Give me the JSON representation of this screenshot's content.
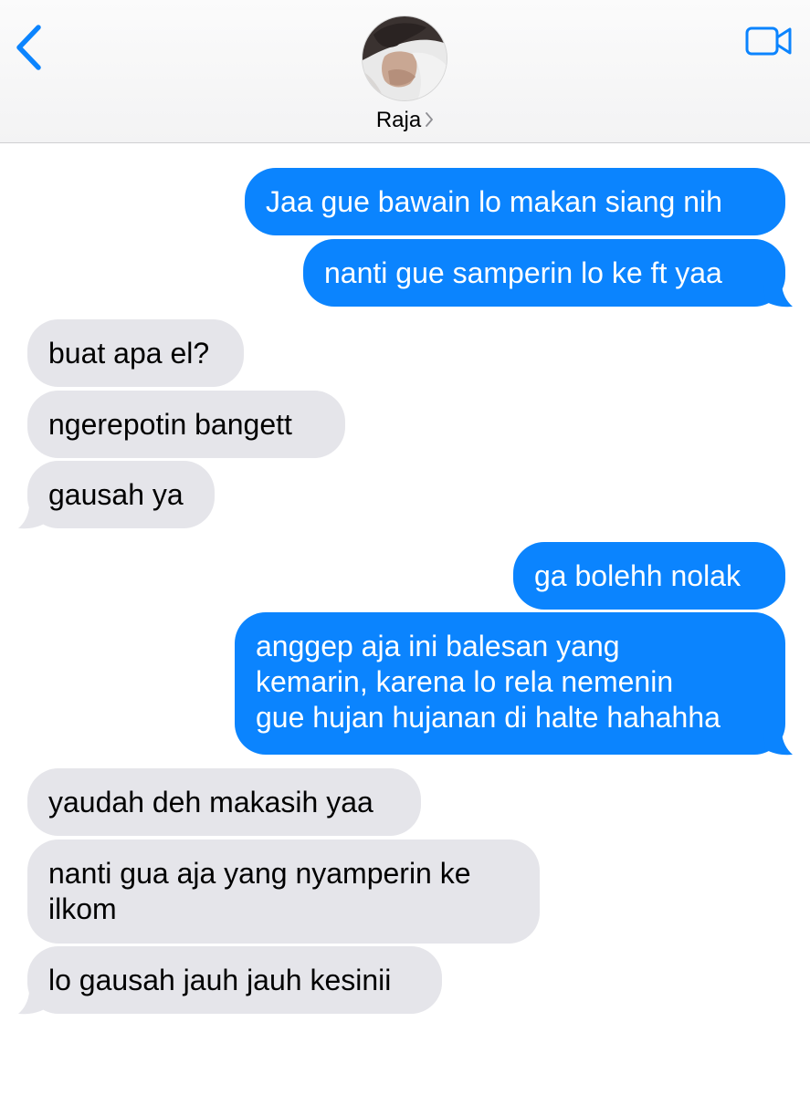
{
  "header": {
    "contact_name": "Raja",
    "icons": {
      "back": "chevron-left-icon",
      "video": "video-camera-icon",
      "disclosure": "chevron-right-icon"
    }
  },
  "colors": {
    "accent": "#0b84fe",
    "outgoing_bubble": "#0b84fe",
    "incoming_bubble": "#e5e5ea",
    "header_background": "#f7f7f7"
  },
  "messages": [
    {
      "direction": "outgoing",
      "text": "Jaa gue bawain lo makan siang nih"
    },
    {
      "direction": "outgoing",
      "text": "nanti gue samperin lo ke ft yaa"
    },
    {
      "direction": "incoming",
      "text": "buat apa el?"
    },
    {
      "direction": "incoming",
      "text": "ngerepotin bangett"
    },
    {
      "direction": "incoming",
      "text": "gausah ya"
    },
    {
      "direction": "outgoing",
      "text": "ga bolehh nolak"
    },
    {
      "direction": "outgoing",
      "lines": [
        "anggep aja ini balesan yang",
        "kemarin, karena lo rela nemenin",
        "gue hujan hujanan di halte hahahha"
      ]
    },
    {
      "direction": "incoming",
      "text": "yaudah deh makasih yaa"
    },
    {
      "direction": "incoming",
      "lines": [
        "nanti gua aja yang nyamperin ke",
        "ilkom"
      ]
    },
    {
      "direction": "incoming",
      "text": "lo gausah jauh jauh kesinii"
    }
  ]
}
